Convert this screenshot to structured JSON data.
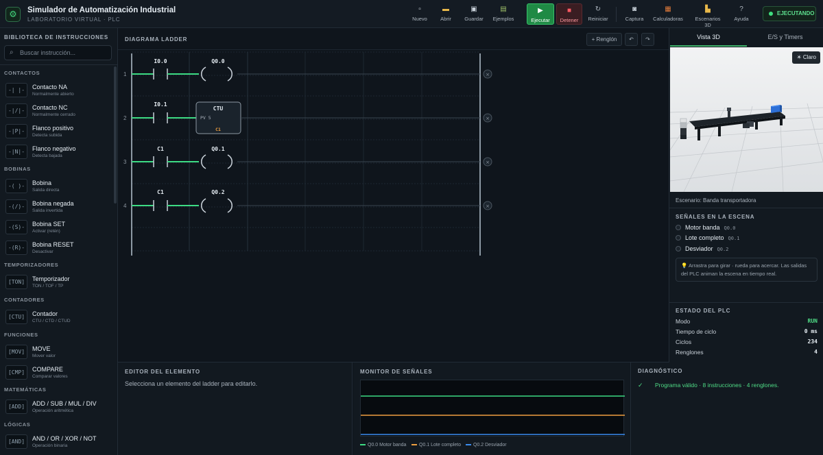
{
  "app": {
    "title": "Simulador de Automatización Industrial",
    "subtitle": "LABORATORIO VIRTUAL · PLC",
    "status": "EJECUTANDO"
  },
  "toolbar": {
    "nuevo": "Nuevo",
    "abrir": "Abrir",
    "guardar": "Guardar",
    "ejemplos": "Ejemplos",
    "ejecutar": "Ejecutar",
    "detener": "Detener",
    "reiniciar": "Reiniciar",
    "captura": "Captura",
    "calculadoras": "Calculadoras",
    "escenarios": "Escenarios 3D",
    "ayuda": "Ayuda"
  },
  "sidebar": {
    "title": "BIBLIOTECA DE INSTRUCCIONES",
    "search_placeholder": "Buscar instrucción...",
    "categories": {
      "contactos": "CONTACTOS",
      "bobinas": "BOBINAS",
      "temporizadores": "TEMPORIZADORES",
      "contadores": "CONTADORES",
      "funciones": "FUNCIONES",
      "matematicas": "MATEMÁTICAS",
      "logicas": "LÓGICAS"
    },
    "items": [
      {
        "name": "Contacto NA",
        "desc": "Normalmente abierto",
        "glyph": "-| |-"
      },
      {
        "name": "Contacto NC",
        "desc": "Normalmente cerrado",
        "glyph": "-|/|-"
      },
      {
        "name": "Flanco positivo",
        "desc": "Detecta subida",
        "glyph": "-|P|-"
      },
      {
        "name": "Flanco negativo",
        "desc": "Detecta bajada",
        "glyph": "-|N|-"
      },
      {
        "name": "Bobina",
        "desc": "Salida directa",
        "glyph": "-( )-"
      },
      {
        "name": "Bobina negada",
        "desc": "Salida invertida",
        "glyph": "-(/)-"
      },
      {
        "name": "Bobina SET",
        "desc": "Activar (retén)",
        "glyph": "-(S)-"
      },
      {
        "name": "Bobina RESET",
        "desc": "Desactivar",
        "glyph": "-(R)-"
      },
      {
        "name": "Temporizador",
        "desc": "TON / TOF / TP",
        "glyph": "[TON]"
      },
      {
        "name": "Contador",
        "desc": "CTU / CTD / CTUD",
        "glyph": "[CTU]"
      },
      {
        "name": "MOVE",
        "desc": "Mover valor",
        "glyph": "[MOV]"
      },
      {
        "name": "COMPARE",
        "desc": "Comparar valores",
        "glyph": "[CMP]"
      },
      {
        "name": "ADD / SUB / MUL / DIV",
        "desc": "Operación aritmética",
        "glyph": "[ADD]"
      },
      {
        "name": "AND / OR / XOR / NOT",
        "desc": "Operación binaria",
        "glyph": "[AND]"
      }
    ]
  },
  "ladder": {
    "title": "DIAGRAMA LADDER",
    "add_rung": "+ Renglón",
    "undo": "↶",
    "redo": "↷",
    "rungs": [
      {
        "number": "1",
        "input": "I0.0",
        "output": "Q0.0",
        "type": "coil"
      },
      {
        "number": "2",
        "input": "I0.1",
        "output": "CTU",
        "type": "counter",
        "pv": "PV 5",
        "tag": "C1"
      },
      {
        "number": "3",
        "input": "C1",
        "output": "Q0.1",
        "type": "coil"
      },
      {
        "number": "4",
        "input": "C1",
        "output": "Q0.2",
        "type": "coil"
      }
    ]
  },
  "right": {
    "tabs": [
      "Vista 3D",
      "E/S y Timers"
    ],
    "claro": "☀ Claro",
    "scene": "Escenario: Banda transportadora",
    "signals_title": "SEÑALES EN LA ESCENA",
    "signals": [
      {
        "name": "Motor banda",
        "addr": "Q0.0"
      },
      {
        "name": "Lote completo",
        "addr": "Q0.1"
      },
      {
        "name": "Desviador",
        "addr": "Q0.2"
      }
    ],
    "hint": "💡 Arrastra para girar · rueda para acercar. Las salidas del PLC animan la escena en tiempo real.",
    "plc_title": "ESTADO DEL PLC",
    "plc": [
      {
        "k": "Modo",
        "v": "RUN"
      },
      {
        "k": "Tiempo de ciclo",
        "v": "0 ms"
      },
      {
        "k": "Ciclos",
        "v": "234"
      },
      {
        "k": "Renglones",
        "v": "4"
      }
    ]
  },
  "bottom": {
    "editor_title": "EDITOR DEL ELEMENTO",
    "editor_msg": "Selecciona un elemento del ladder para editarlo.",
    "monitor_title": "MONITOR DE SEÑALES",
    "legend": [
      "Q0.0 Motor banda",
      "Q0.1 Lote completo",
      "Q0.2 Desviador"
    ],
    "diag_title": "DIAGNÓSTICO",
    "diag_msg": "Programa válido · 8 instrucciones · 4 renglones."
  },
  "colors": {
    "accent": "#3fe07f",
    "energized": "#3ddc84",
    "orange": "#f0a040",
    "blue": "#3b8df0"
  }
}
